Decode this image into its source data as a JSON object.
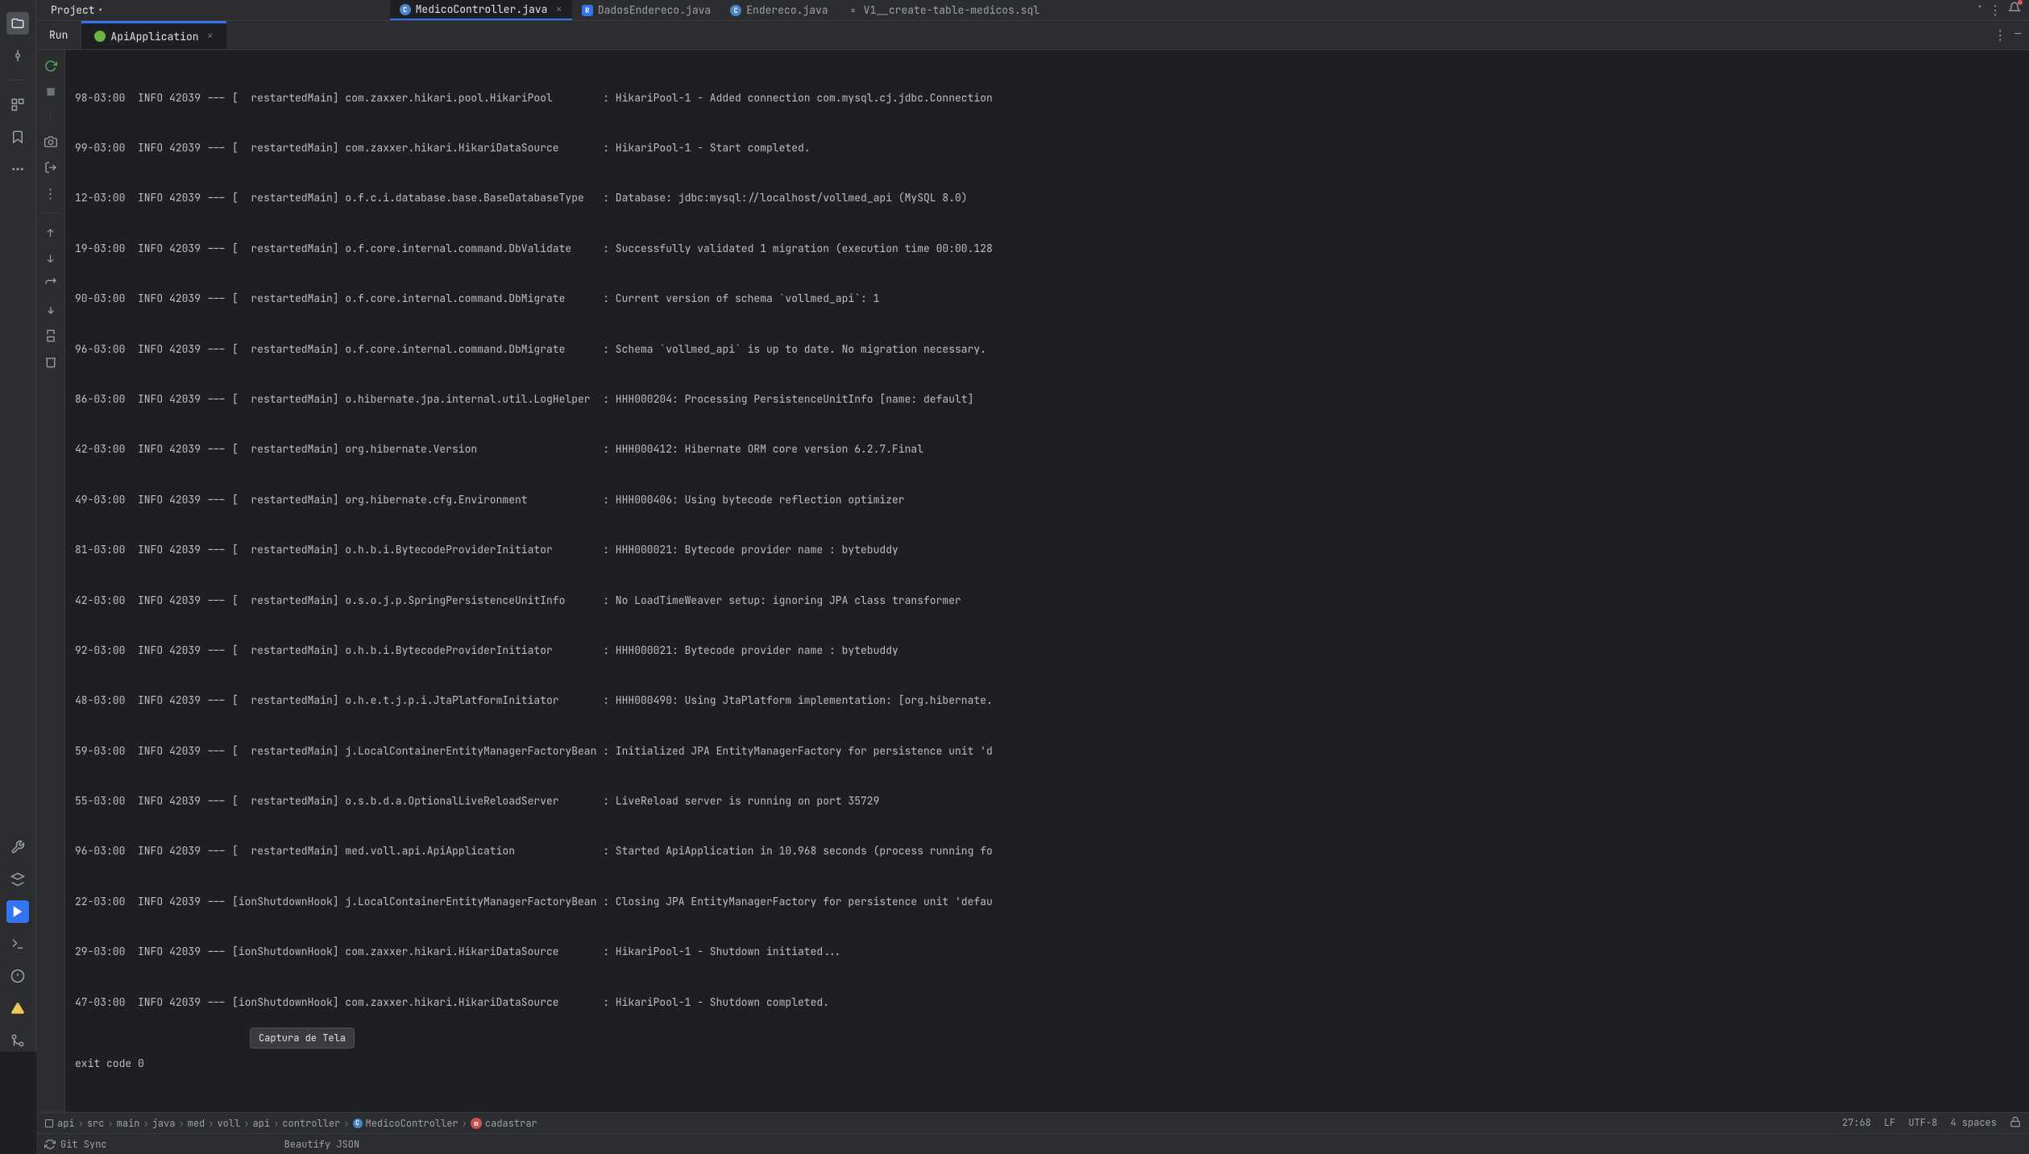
{
  "project": {
    "label": "Project"
  },
  "tabs": [
    {
      "name": "MedicoController.java",
      "type": "java-c",
      "letter": "C",
      "active": true,
      "closable": true
    },
    {
      "name": "DadosEndereco.java",
      "type": "java-r",
      "letter": "R",
      "active": false
    },
    {
      "name": "Endereco.java",
      "type": "java-c",
      "letter": "C",
      "active": false
    },
    {
      "name": "V1__create-table-medicos.sql",
      "type": "sql",
      "letter": "≡",
      "active": false
    }
  ],
  "run": {
    "label": "Run",
    "config": "ApiApplication",
    "close": "×"
  },
  "console": {
    "lines": [
      "98-03:00  INFO 42039 --- [  restartedMain] com.zaxxer.hikari.pool.HikariPool        : HikariPool-1 - Added connection com.mysql.cj.jdbc.Connection",
      "99-03:00  INFO 42039 --- [  restartedMain] com.zaxxer.hikari.HikariDataSource       : HikariPool-1 - Start completed.",
      "12-03:00  INFO 42039 --- [  restartedMain] o.f.c.i.database.base.BaseDatabaseType   : Database: jdbc:mysql://localhost/vollmed_api (MySQL 8.0)",
      "19-03:00  INFO 42039 --- [  restartedMain] o.f.core.internal.command.DbValidate     : Successfully validated 1 migration (execution time 00:00.128",
      "90-03:00  INFO 42039 --- [  restartedMain] o.f.core.internal.command.DbMigrate      : Current version of schema `vollmed_api`: 1",
      "96-03:00  INFO 42039 --- [  restartedMain] o.f.core.internal.command.DbMigrate      : Schema `vollmed_api` is up to date. No migration necessary.",
      "86-03:00  INFO 42039 --- [  restartedMain] o.hibernate.jpa.internal.util.LogHelper  : HHH000204: Processing PersistenceUnitInfo [name: default]",
      "42-03:00  INFO 42039 --- [  restartedMain] org.hibernate.Version                    : HHH000412: Hibernate ORM core version 6.2.7.Final",
      "49-03:00  INFO 42039 --- [  restartedMain] org.hibernate.cfg.Environment            : HHH000406: Using bytecode reflection optimizer",
      "81-03:00  INFO 42039 --- [  restartedMain] o.h.b.i.BytecodeProviderInitiator        : HHH000021: Bytecode provider name : bytebuddy",
      "42-03:00  INFO 42039 --- [  restartedMain] o.s.o.j.p.SpringPersistenceUnitInfo      : No LoadTimeWeaver setup: ignoring JPA class transformer",
      "92-03:00  INFO 42039 --- [  restartedMain] o.h.b.i.BytecodeProviderInitiator        : HHH000021: Bytecode provider name : bytebuddy",
      "48-03:00  INFO 42039 --- [  restartedMain] o.h.e.t.j.p.i.JtaPlatformInitiator       : HHH000490: Using JtaPlatform implementation: [org.hibernate.",
      "59-03:00  INFO 42039 --- [  restartedMain] j.LocalContainerEntityManagerFactoryBean : Initialized JPA EntityManagerFactory for persistence unit 'd",
      "55-03:00  INFO 42039 --- [  restartedMain] o.s.b.d.a.OptionalLiveReloadServer       : LiveReload server is running on port 35729",
      "96-03:00  INFO 42039 --- [  restartedMain] med.voll.api.ApiApplication              : Started ApiApplication in 10.968 seconds (process running fo",
      "22-03:00  INFO 42039 --- [ionShutdownHook] j.LocalContainerEntityManagerFactoryBean : Closing JPA EntityManagerFactory for persistence unit 'defau",
      "29-03:00  INFO 42039 --- [ionShutdownHook] com.zaxxer.hikari.HikariDataSource       : HikariPool-1 - Shutdown initiated...",
      "47-03:00  INFO 42039 --- [ionShutdownHook] com.zaxxer.hikari.HikariDataSource       : HikariPool-1 - Shutdown completed."
    ],
    "exit": "exit code 0"
  },
  "breadcrumb": {
    "items": [
      "api",
      "src",
      "main",
      "java",
      "med",
      "voll",
      "api",
      "controller",
      "MedicoController",
      "cadastrar"
    ]
  },
  "status": {
    "position": "27:68",
    "line_sep": "LF",
    "encoding": "UTF-8",
    "indent": "4 spaces"
  },
  "bottom": {
    "git": "Git Sync",
    "beautify": "Beautify JSON",
    "tooltip": "Captura de Tela"
  }
}
